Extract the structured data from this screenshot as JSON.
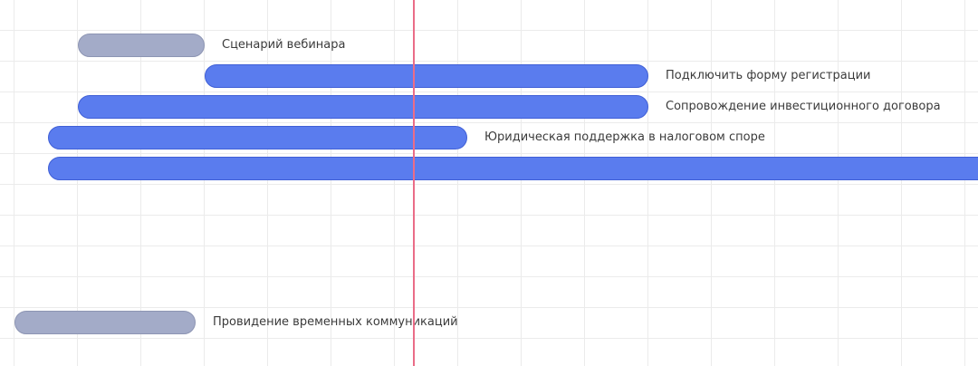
{
  "colors": {
    "task_blue": "#5a7cee",
    "task_gray": "#a3abc8",
    "today_line": "#ea6d88",
    "grid": "#ebebeb"
  },
  "tasks": [
    {
      "label": "Сценарий вебинара",
      "status": "gray"
    },
    {
      "label": "Подключить форму регистрации",
      "status": "blue"
    },
    {
      "label": "Сопровождение инвестиционного договора",
      "status": "blue"
    },
    {
      "label": "Юридическая поддержка в налоговом споре",
      "status": "blue"
    },
    {
      "label": "",
      "status": "blue"
    },
    {
      "label": "Провидение временных коммуникаций",
      "status": "gray"
    }
  ]
}
